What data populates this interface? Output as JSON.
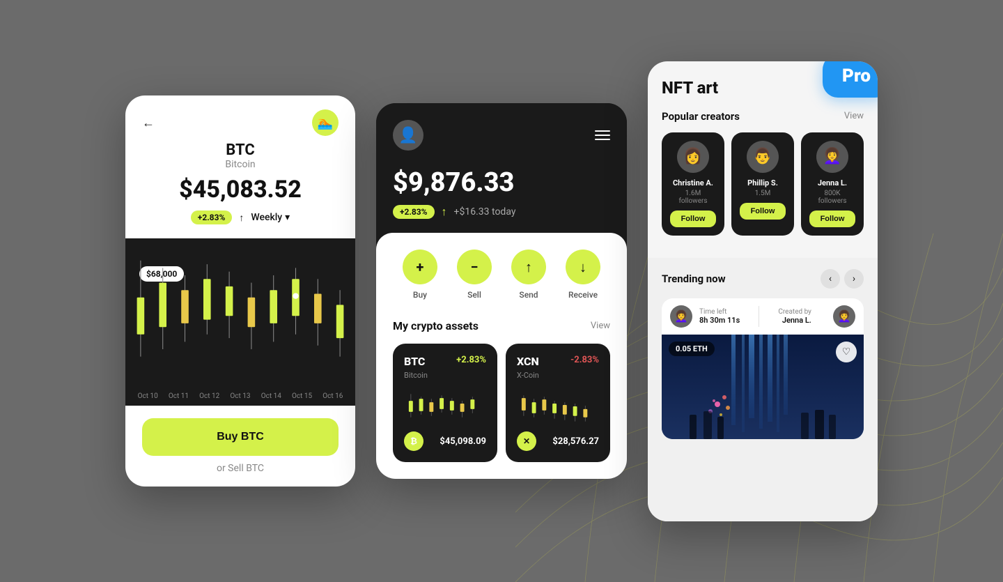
{
  "background": "#6b6b6b",
  "cards": {
    "btc": {
      "title": "BTC",
      "subtitle": "Bitcoin",
      "price": "$45,083.52",
      "change_pct": "+2.83%",
      "period": "Weekly",
      "price_label": "$68,000",
      "chart_labels": [
        "Oct 10",
        "Oct 11",
        "Oct 12",
        "Oct 13",
        "Oct 14",
        "Oct 15",
        "Oct 16"
      ],
      "buy_btn": "Buy BTC",
      "sell_link": "or Sell BTC"
    },
    "wallet": {
      "balance": "$9,876.33",
      "change_pct": "+2.83%",
      "change_arrow": "↑",
      "change_text": "+$16.33 today",
      "actions": [
        {
          "label": "Buy",
          "icon": "+"
        },
        {
          "label": "Sell",
          "icon": "−"
        },
        {
          "label": "Send",
          "icon": "↑"
        },
        {
          "label": "Receive",
          "icon": "↓"
        }
      ],
      "assets_title": "My crypto assets",
      "assets_view": "View",
      "assets": [
        {
          "symbol": "BTC",
          "name": "Bitcoin",
          "change": "+2.83%",
          "change_type": "positive",
          "price": "$45,098.09",
          "icon": "₿"
        },
        {
          "symbol": "XCN",
          "name": "X-Coin",
          "change": "-2.83%",
          "change_type": "negative",
          "price": "$28,576.27",
          "icon": "✕"
        }
      ]
    },
    "nft": {
      "title": "NFT art",
      "pro_label": "Pro",
      "popular_creators_title": "Popular creators",
      "popular_creators_view": "View",
      "creators": [
        {
          "name": "Christine A.",
          "followers": "1.6M followers",
          "follow_btn": "Follow"
        },
        {
          "name": "Phillip S.",
          "followers": "1.5M",
          "follow_btn": "Follow"
        },
        {
          "name": "Jenna L.",
          "followers": "800K followers",
          "follow_btn": "Follow"
        }
      ],
      "trending_title": "Trending now",
      "trending_time_label": "Time left",
      "trending_time": "8h 30m 11s",
      "trending_created_by": "Created by",
      "trending_creator": "Jenna L.",
      "trending_eth": "0.05 ETH"
    }
  }
}
